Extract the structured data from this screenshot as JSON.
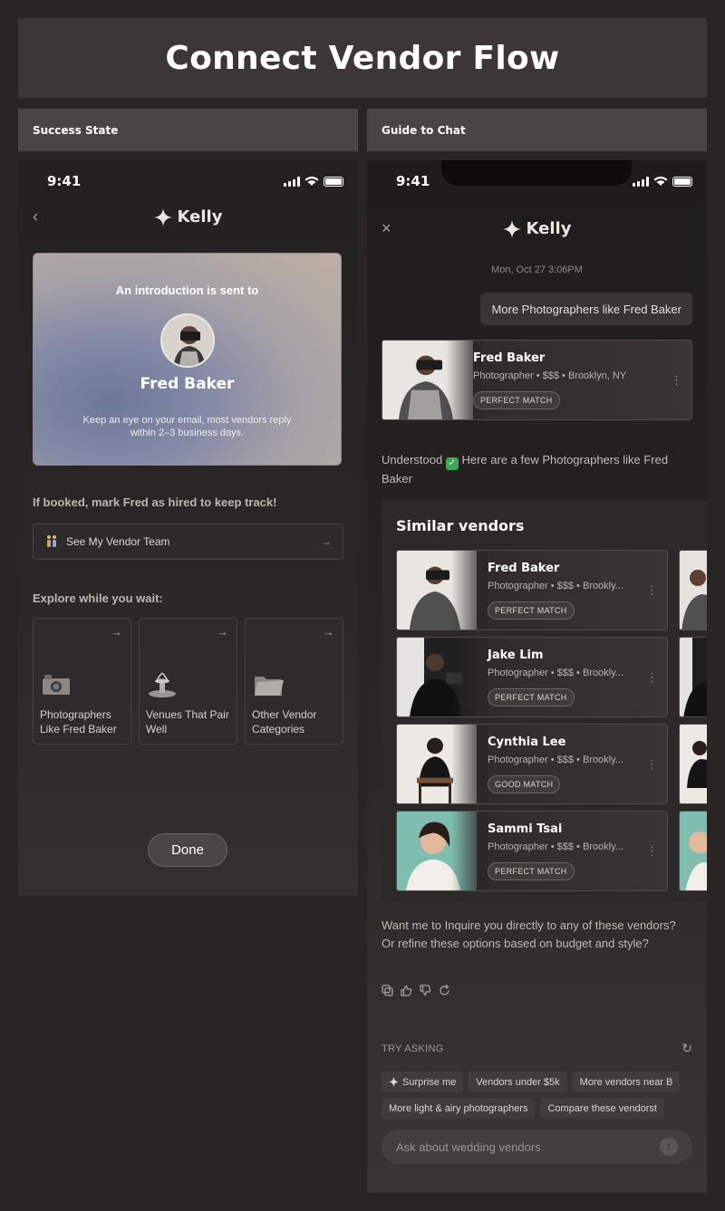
{
  "page": {
    "title": "Connect Vendor Flow",
    "sections": [
      "Success State",
      "Guide to Chat"
    ]
  },
  "left_phone": {
    "status_time": "9:41",
    "brand": "Kelly",
    "intro": {
      "lead": "An introduction is sent to",
      "name": "Fred Baker",
      "note": "Keep an eye on your email, most vendors reply within 2–3 business days."
    },
    "hint": "If booked, mark Fred as hired to keep track!",
    "vendor_team_label": "See My Vendor Team",
    "explore_label": "Explore while you wait:",
    "tiles": [
      {
        "label": "Photographers Like Fred Baker",
        "icon": "camera-icon"
      },
      {
        "label": "Venues That Pair Well",
        "icon": "fountain-icon"
      },
      {
        "label": "Other Vendor Categories",
        "icon": "folder-icon"
      }
    ],
    "done_label": "Done"
  },
  "right_phone": {
    "status_time": "9:41",
    "brand": "Kelly",
    "timestamp": "Mon, Oct 27 3:06PM",
    "user_message": "More Photographers like Fred Baker",
    "top_vendor": {
      "name": "Fred Baker",
      "meta": "Photographer • $$$ • Brooklyn, NY",
      "badge": "PERFECT MATCH"
    },
    "understood_text": "Understood",
    "understood_rest": " Here are a few Photographers like Fred Baker",
    "similar_title": "Similar vendors",
    "similar": [
      {
        "name": "Fred Baker",
        "meta": "Photographer • $$$ • Brookly...",
        "badge": "PERFECT MATCH"
      },
      {
        "name": "Jake Lim",
        "meta": "Photographer • $$$ • Brookly...",
        "badge": "PERFECT MATCH"
      },
      {
        "name": "Cynthia Lee",
        "meta": "Photographer • $$$ • Brookly...",
        "badge": "GOOD MATCH"
      },
      {
        "name": "Sammi Tsai",
        "meta": "Photographer • $$$ • Brookly...",
        "badge": "PERFECT MATCH"
      }
    ],
    "want_text": "Want me to Inquire you directly to any of these vendors? Or refine these options based on budget and style?",
    "try_label": "TRY ASKING",
    "chips_row1": [
      "Surprise me",
      "Vendors under $5k",
      "More vendors near B"
    ],
    "chips_row2": [
      "More light & airy photographers",
      "Compare these vendorst"
    ],
    "ask_placeholder": "Ask about wedding vendors"
  }
}
